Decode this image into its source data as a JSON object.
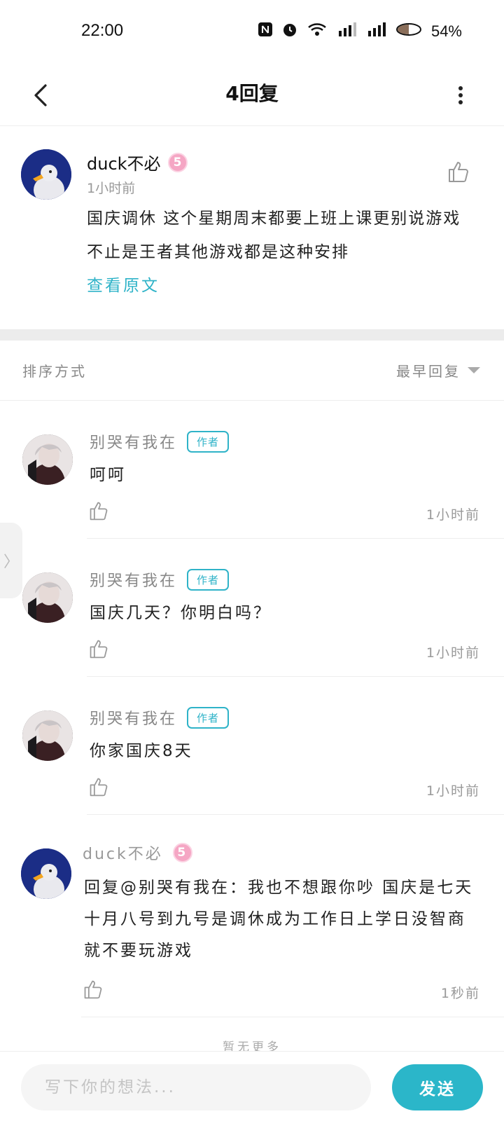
{
  "status_bar": {
    "time": "22:00",
    "battery": "54%",
    "icons": [
      "nfc-icon",
      "alarm-icon",
      "wifi-icon",
      "hd-signal-icon",
      "4g-signal-icon",
      "battery-icon"
    ]
  },
  "header": {
    "title": "4回复",
    "back_icon": "chevron-left-icon",
    "more_icon": "more-vertical-icon"
  },
  "root_comment": {
    "username": "duck不必",
    "level": "5",
    "time": "1小时前",
    "text": "国庆调休 这个星期周末都要上班上课更别说游戏 不止是王者其他游戏都是这种安排",
    "view_original": "查看原文"
  },
  "sort": {
    "label": "排序方式",
    "selected": "最早回复"
  },
  "replies": [
    {
      "username": "别哭有我在",
      "badge": "作者",
      "text": "呵呵",
      "time": "1小时前"
    },
    {
      "username": "别哭有我在",
      "badge": "作者",
      "text": "国庆几天？你明白吗？",
      "time": "1小时前"
    },
    {
      "username": "别哭有我在",
      "badge": "作者",
      "text": "你家国庆8天",
      "time": "1小时前"
    },
    {
      "username": "duck不必",
      "level": "5",
      "text": "回复@别哭有我在：我也不想跟你吵 国庆是七天 十月八号到九号是调休成为工作日上学日没智商就不要玩游戏",
      "time": "1秒前"
    }
  ],
  "no_more_text": "暂无更多",
  "comment_bar": {
    "placeholder": "写下你的想法...",
    "send_label": "发送"
  },
  "colors": {
    "accent": "#2bb6c9",
    "level_badge": "#f5a6c4"
  }
}
